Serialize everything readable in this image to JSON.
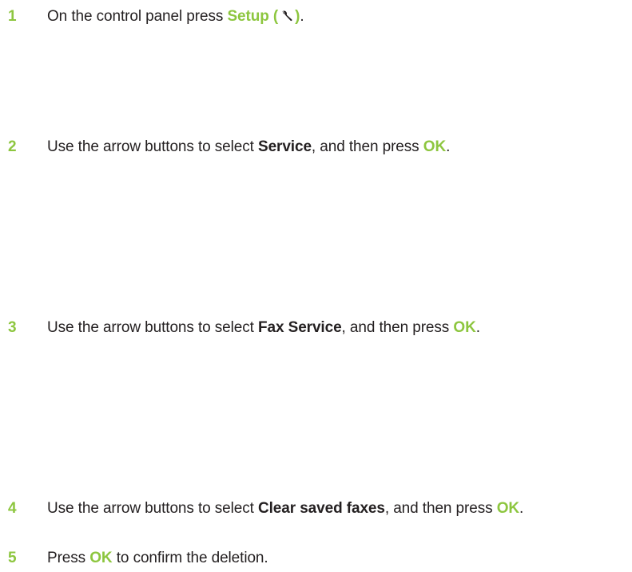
{
  "accent_color": "#8dc63f",
  "steps": [
    {
      "number": "1",
      "text_before": "On the control panel press ",
      "button": "Setup (",
      "button_close": ")",
      "button_icon": "wrench-icon",
      "text_after": "."
    },
    {
      "number": "2",
      "text_before": "Use the arrow buttons to select ",
      "item": "Service",
      "text_mid": ", and then press ",
      "button": "OK",
      "text_after": "."
    },
    {
      "number": "3",
      "text_before": "Use the arrow buttons to select ",
      "item": "Fax Service",
      "text_mid": ", and then press ",
      "button": "OK",
      "text_after": "."
    },
    {
      "number": "4",
      "text_before": "Use the arrow buttons to select ",
      "item": "Clear saved faxes",
      "text_mid": ", and then press ",
      "button": "OK",
      "text_after": "."
    },
    {
      "number": "5",
      "text_before": "Press ",
      "button": "OK",
      "text_after": " to confirm the deletion."
    }
  ]
}
